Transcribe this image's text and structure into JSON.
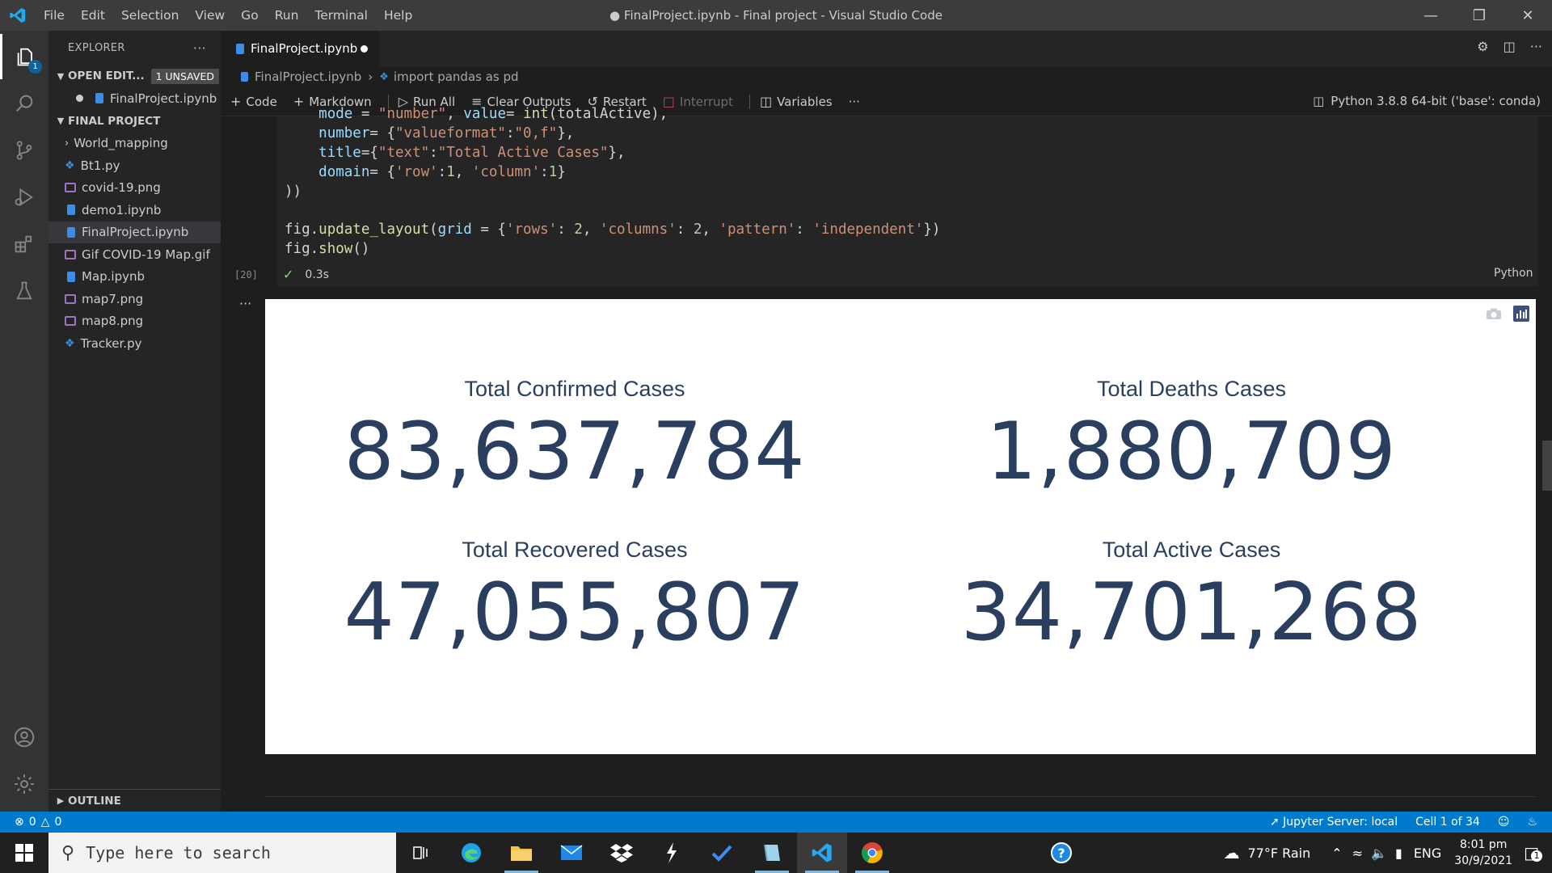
{
  "titlebar": {
    "menu": [
      "File",
      "Edit",
      "Selection",
      "View",
      "Go",
      "Run",
      "Terminal",
      "Help"
    ],
    "title": "● FinalProject.ipynb - Final project - Visual Studio Code"
  },
  "activity_bar": {
    "explorer_badge": "1"
  },
  "sidebar": {
    "header": "EXPLORER",
    "open_editors_label": "OPEN EDIT...",
    "unsaved_label": "1 UNSAVED",
    "open_editor_file": "FinalProject.ipynb",
    "project_label": "FINAL PROJECT",
    "files": [
      {
        "name": "World_mapping",
        "type": "folder"
      },
      {
        "name": "Bt1.py",
        "type": "py"
      },
      {
        "name": "covid-19.png",
        "type": "img"
      },
      {
        "name": "demo1.ipynb",
        "type": "nb"
      },
      {
        "name": "FinalProject.ipynb",
        "type": "nb"
      },
      {
        "name": "Gif COVID-19 Map.gif",
        "type": "img"
      },
      {
        "name": "Map.ipynb",
        "type": "nb"
      },
      {
        "name": "map7.png",
        "type": "img"
      },
      {
        "name": "map8.png",
        "type": "img"
      },
      {
        "name": "Tracker.py",
        "type": "py"
      }
    ],
    "outline_label": "OUTLINE"
  },
  "tabs": [
    {
      "label": "FinalProject.ipynb",
      "modified": true
    }
  ],
  "breadcrumb": {
    "file": "FinalProject.ipynb",
    "cell": "import pandas as pd"
  },
  "toolbar": {
    "code": "Code",
    "markdown": "Markdown",
    "run_all": "Run All",
    "clear_outputs": "Clear Outputs",
    "restart": "Restart",
    "interrupt": "Interrupt",
    "variables": "Variables",
    "kernel": "Python 3.8.8 64-bit ('base': conda)"
  },
  "cell": {
    "exec_count": "[20]",
    "duration": "0.3s",
    "language": "Python"
  },
  "indicators": [
    {
      "title": "Total Confirmed Cases",
      "value": "83,637,784"
    },
    {
      "title": "Total Deaths Cases",
      "value": "1,880,709"
    },
    {
      "title": "Total Recovered Cases",
      "value": "47,055,807"
    },
    {
      "title": "Total Active Cases",
      "value": "34,701,268"
    }
  ],
  "statusbar": {
    "errors": "0",
    "warnings": "0",
    "jupyter_server": "Jupyter Server: local",
    "cell_position": "Cell 1 of 34"
  },
  "taskbar": {
    "search_placeholder": "Type here to search",
    "weather": "77°F  Rain",
    "language": "ENG",
    "time": "8:01 pm",
    "date": "30/9/2021",
    "notifications": "1"
  },
  "colors": {
    "accent": "#007acc",
    "indicator_text": "#2a3f5f"
  }
}
